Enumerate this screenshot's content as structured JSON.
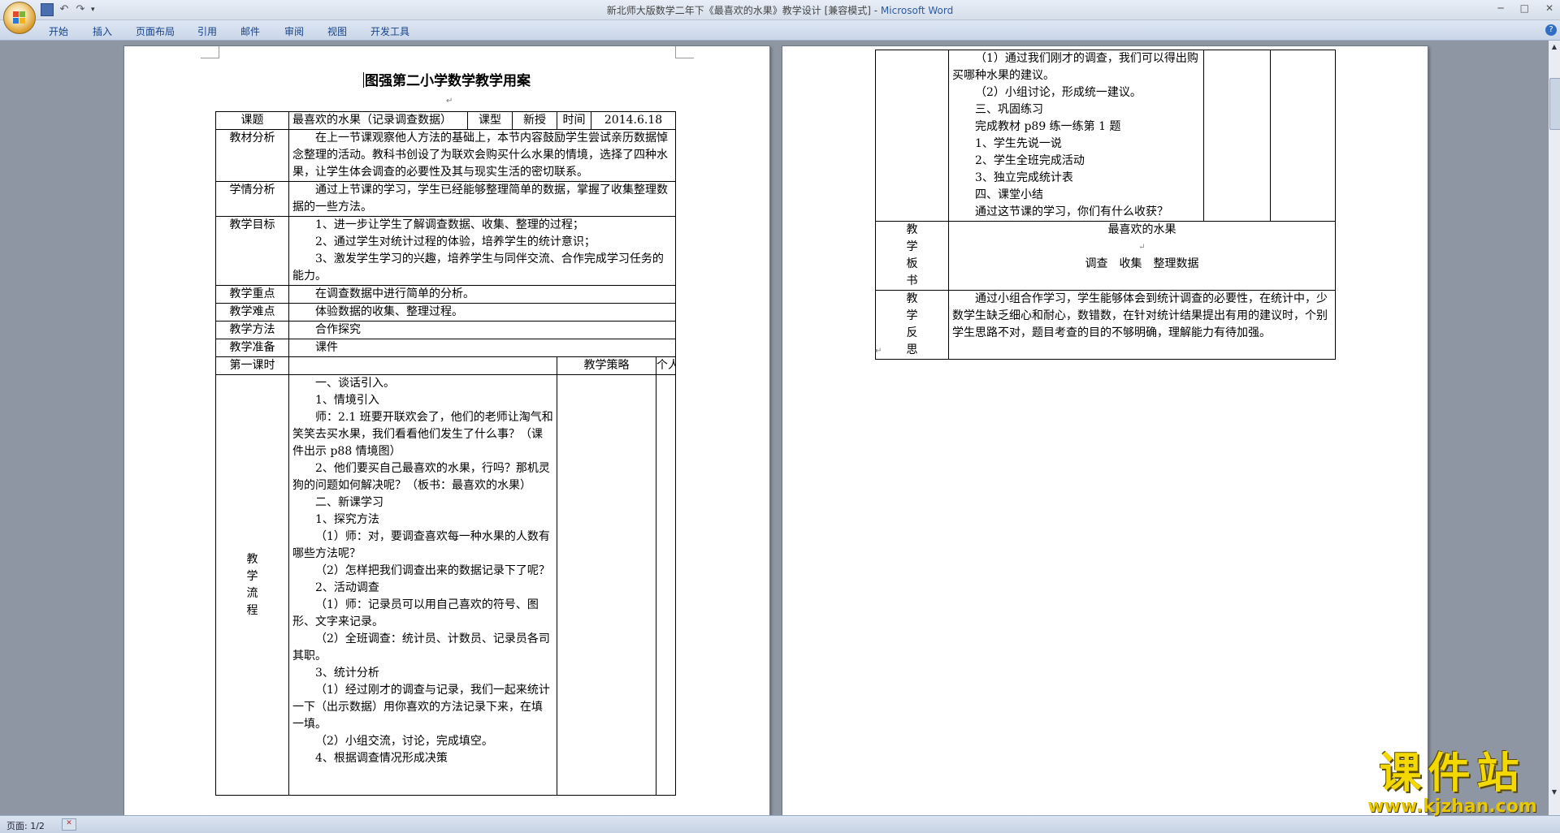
{
  "window": {
    "title_doc": "新北师大版数学二年下《最喜欢的水果》教学设计 [兼容模式] - ",
    "title_app": "Microsoft Word"
  },
  "ribbon": {
    "tabs": [
      "开始",
      "插入",
      "页面布局",
      "引用",
      "邮件",
      "审阅",
      "视图",
      "开发工具"
    ]
  },
  "statusbar": {
    "page": "页面: 1/2"
  },
  "watermark": {
    "name": "课件站",
    "url": "www.kjzhan.com"
  },
  "page1": {
    "title": "图强第二小学数学教学用案",
    "header": {
      "subject_label": "课题",
      "subject": "最喜欢的水果（记录调查数据）",
      "type_label": "课型",
      "type": "新授",
      "time_label": "时间",
      "time": "2014.6.18"
    },
    "material_label": "教材分析",
    "material": "在上一节课观察他人方法的基础上，本节内容鼓励学生尝试亲历数据悼念整理的活动。教科书创设了为联欢会购买什么水果的情境，选择了四种水果，让学生体会调查的必要性及其与现实生活的密切联系。",
    "students_label": "学情分析",
    "students": "通过上节课的学习，学生已经能够整理简单的数据，掌握了收集整理数据的一些方法。",
    "goals_label": "教学目标",
    "goals": [
      "1、进一步让学生了解调查数据、收集、整理的过程；",
      "2、通过学生对统计过程的体验，培养学生的统计意识；",
      "3、激发学生学习的兴趣，培养学生与同伴交流、合作完成学习任务的能力。"
    ],
    "key_label": "教学重点",
    "key": "在调查数据中进行简单的分析。",
    "difficult_label": "教学难点",
    "difficult": "体验数据的收集、整理过程。",
    "method_label": "教学方法",
    "method": "合作探究",
    "prep_label": "教学准备",
    "prep": "课件",
    "period_label": "第一课时",
    "strategy_label": "教学策略",
    "personal_label": "个人加减",
    "process_label": [
      "教",
      "学",
      "流",
      "程"
    ],
    "process": [
      "一、谈话引入。",
      "1、情境引入",
      "师：2.1 班要开联欢会了，他们的老师让淘气和笑笑去买水果，我们看看他们发生了什么事？（课件出示 p88 情境图）",
      "2、他们要买自己最喜欢的水果，行吗？那机灵狗的问题如何解决呢？（板书：最喜欢的水果）",
      "二、新课学习",
      "1、探究方法",
      "（1）师：对，要调查喜欢每一种水果的人数有哪些方法呢？",
      "（2）怎样把我们调查出来的数据记录下了呢？",
      "2、活动调查",
      "（1）师：记录员可以用自己喜欢的符号、图形、文字来记录。",
      "（2）全班调查：统计员、计数员、记录员各司其职。",
      "3、统计分析",
      "（1）经过刚才的调查与记录，我们一起来统计一下（出示数据）用你喜欢的方法记录下来，在填一填。",
      "（2）小组交流，讨论，完成填空。",
      "4、根据调查情况形成决策"
    ]
  },
  "page2": {
    "process": [
      "（1）通过我们刚才的调查，我们可以得出购买哪种水果的建议。",
      "（2）小组讨论，形成统一建议。",
      "三、巩固练习",
      "完成教材 p89 练一练第 1 题",
      "1、学生先说一说",
      "2、学生全班完成活动",
      "3、独立完成统计表",
      "四、课堂小结",
      "通过这节课的学习，你们有什么收获？"
    ],
    "board_label": [
      "教",
      "学",
      "板",
      "书"
    ],
    "board_title": "最喜欢的水果",
    "board_line": "调查　收集　整理数据",
    "reflect_label": [
      "教",
      "学",
      "反",
      "思"
    ],
    "reflect": "通过小组合作学习，学生能够体会到统计调查的必要性，在统计中，少数学生缺乏细心和耐心，数错数，在针对统计结果提出有用的建议时，个别学生思路不对，题目考查的目的不够明确，理解能力有待加强。"
  }
}
